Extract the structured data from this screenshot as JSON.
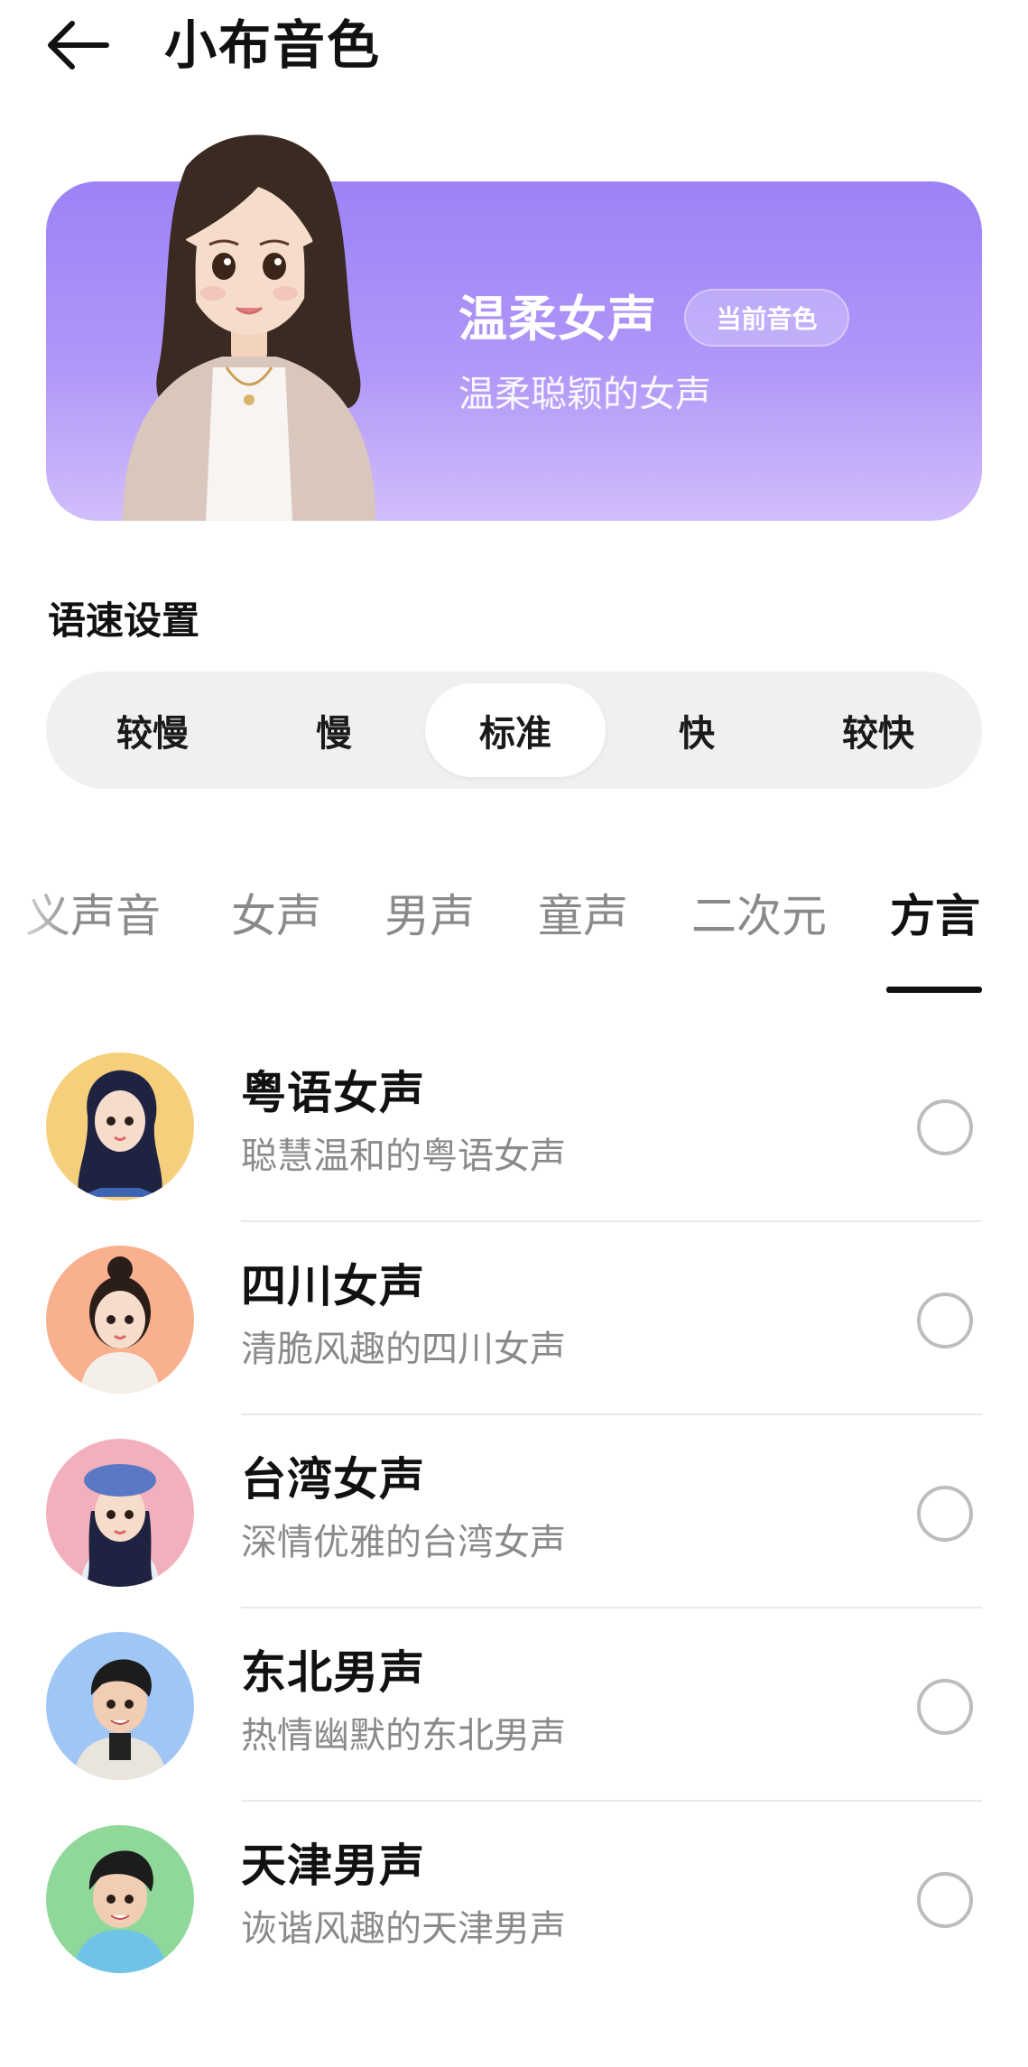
{
  "header": {
    "title": "小布音色",
    "back_icon": "arrow-left-icon"
  },
  "hero": {
    "name": "温柔女声",
    "badge": "当前音色",
    "description": "温柔聪颖的女声",
    "background_colors": [
      "#9c82f6",
      "#d2bdfb"
    ]
  },
  "speed": {
    "title": "语速设置",
    "options": [
      "较慢",
      "慢",
      "标准",
      "快",
      "较快"
    ],
    "selected": "标准"
  },
  "categories": {
    "tabs": [
      "义声音",
      "女声",
      "男声",
      "童声",
      "二次元",
      "方言"
    ],
    "active": "方言"
  },
  "voices": [
    {
      "name": "粤语女声",
      "description": "聪慧温和的粤语女声",
      "avatar_bg": "#f6cf7d",
      "selected": false
    },
    {
      "name": "四川女声",
      "description": "清脆风趣的四川女声",
      "avatar_bg": "#f8b08f",
      "selected": false
    },
    {
      "name": "台湾女声",
      "description": "深情优雅的台湾女声",
      "avatar_bg": "#f2b0bd",
      "selected": false
    },
    {
      "name": "东北男声",
      "description": "热情幽默的东北男声",
      "avatar_bg": "#9fc6f4",
      "selected": false
    },
    {
      "name": "天津男声",
      "description": "诙谐风趣的天津男声",
      "avatar_bg": "#8fd89a",
      "selected": false
    }
  ]
}
